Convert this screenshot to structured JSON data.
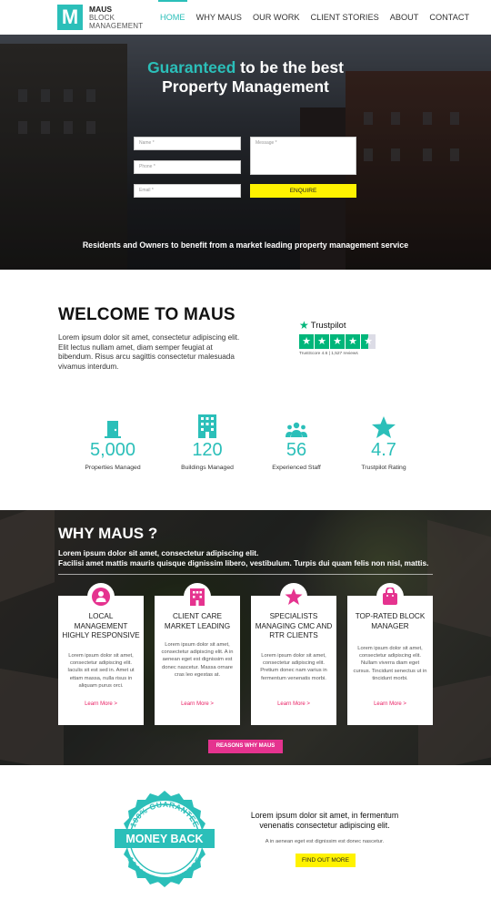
{
  "header": {
    "logo_letter": "M",
    "logo_name": "MAUS",
    "logo_tag": "BLOCK MANAGEMENT",
    "nav": [
      "HOME",
      "WHY MAUS",
      "OUR WORK",
      "CLIENT STORIES",
      "ABOUT",
      "CONTACT"
    ]
  },
  "hero": {
    "title_accent": "Guaranteed",
    "title_rest": " to be the best",
    "title_line2": "Property Management",
    "form": {
      "name_placeholder": "Name *",
      "phone_placeholder": "Phone *",
      "email_placeholder": "Email *",
      "message_placeholder": "Message *",
      "submit_label": "ENQUIRE"
    },
    "subtitle": "Residents and Owners to benefit from a market leading property management service"
  },
  "welcome": {
    "title": "WELCOME TO MAUS",
    "text": "Lorem ipsum dolor sit amet, consectetur adipiscing elit. Elit lectus nullam amet, diam semper feugiat at bibendum. Risus arcu sagittis consectetur malesuada vivamus interdum.",
    "trustpilot": {
      "brand": "Trustpilot",
      "score_text": "TrustScore 4.6 | 1,527 reviews",
      "stars": 4.5
    }
  },
  "stats": [
    {
      "value": "5,000",
      "label": "Properties Managed",
      "icon": "door-icon"
    },
    {
      "value": "120",
      "label": "Buildings Managed",
      "icon": "building-icon"
    },
    {
      "value": "56",
      "label": "Experienced Staff",
      "icon": "team-icon"
    },
    {
      "value": "4.7",
      "label": "Trustpilot Rating",
      "icon": "star-icon"
    }
  ],
  "why": {
    "title": "WHY MAUS ?",
    "text_line1": "Lorem ipsum dolor sit amet, consectetur adipiscing elit.",
    "text_line2": "Facilisi amet mattis mauris quisque dignissim libero, vestibulum. Turpis dui quam felis non nisl, mattis.",
    "cards": [
      {
        "title": "LOCAL MANAGEMENT HIGHLY RESPONSIVE",
        "text": "Lorem ipsum dolor sit amet, consectetur adipiscing elit. Iaculis sit est sed in. Amet ut ettam massa, nulla risus in aliquam purus orci.",
        "link": "Learn More >",
        "icon": "person-icon"
      },
      {
        "title": "CLIENT CARE MARKET LEADING",
        "text": "Lorem ipsum dolor sit amet, consectetur adipiscing elit. A in aenean eget est dignissim est donec nascetur. Massa ornare cras leo egestas at.",
        "link": "Learn More >",
        "icon": "building-icon"
      },
      {
        "title": "SPECIALISTS MANAGING CMC AND RTR CLIENTS",
        "text": "Lorem ipsum dolor sit amet, consectetur adipiscing elit. Pretium donec nam varius in fermentum venenatis morbi.",
        "link": "Learn More >",
        "icon": "star-icon"
      },
      {
        "title": "TOP-RATED BLOCK MANAGER",
        "text": "Lorem ipsum dolor sit amet, consectetur adipiscing elit. Nullam viverra diam eget cursus. Tincidunt senectus ut in tincidunt morbi.",
        "link": "Learn More >",
        "icon": "bag-icon"
      }
    ],
    "button": "REASONS WHY MAUS"
  },
  "money_back": {
    "badge_top": "100% GUARANTEE",
    "badge_main": "MONEY BACK",
    "badge_bottom": "100% GUARANTEE",
    "title": "Lorem ipsum dolor sit amet, in fermentum venenatis consectetur adipiscing elit.",
    "subtitle": "A in aenean eget est dignissim est donec nascetur.",
    "button": "FIND OUT MORE"
  },
  "colors": {
    "accent": "#2bbfb9",
    "pink": "#e5338f",
    "yellow": "#fff200",
    "trustpilot": "#00b67a"
  }
}
